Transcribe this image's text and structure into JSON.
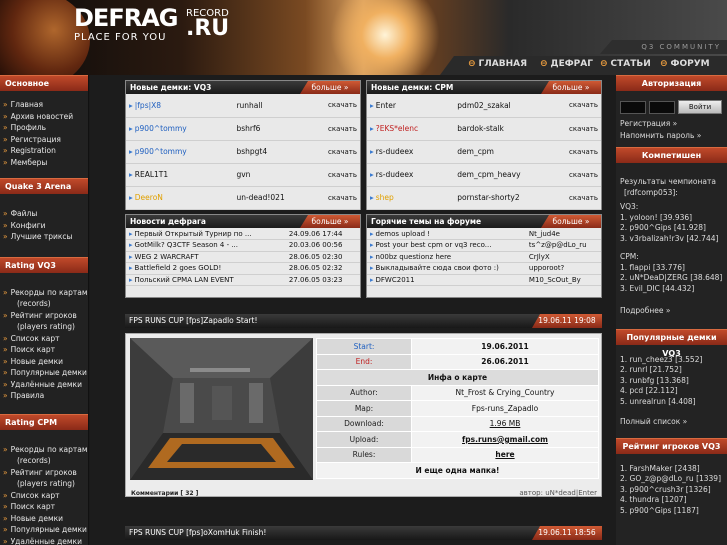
{
  "header": {
    "logo_main": "DEFRAG",
    "logo_record": "RECORD",
    "logo_ru": ".RU",
    "logo_sub": "PLACE FOR YOU",
    "community": "Q3 COMMUNITY",
    "nav": [
      {
        "label": "ГЛАВНАЯ",
        "icon": "circle-arrow-icon"
      },
      {
        "label": "ДЕФРАГ",
        "icon": "circle-arrow-icon"
      },
      {
        "label": "СТАТЬИ",
        "icon": "circle-arrow-icon"
      },
      {
        "label": "ФОРУМ",
        "icon": "circle-arrow-icon"
      }
    ]
  },
  "left_sidebar": {
    "sections": [
      {
        "title": "Основное",
        "items": [
          "Главная",
          "Архив новостей",
          "Профиль",
          "Регистрация",
          "Registration",
          "Мемберы"
        ]
      },
      {
        "title": "Quake 3 Arena",
        "items": [
          "Файлы",
          "Конфиги",
          "Лучшие триксы"
        ]
      },
      {
        "title": "Rating VQ3",
        "items": [
          "Рекорды по картам",
          "(records)",
          "Рейтинг игроков",
          "(players rating)",
          "Список карт",
          "Поиск карт",
          "Новые демки",
          "Популярные демки",
          "Удалённые демки",
          "Правила"
        ]
      },
      {
        "title": "Rating CPM",
        "items": [
          "Рекорды по картам",
          "(records)",
          "Рейтинг игроков",
          "(players rating)",
          "Список карт",
          "Поиск карт",
          "Новые демки",
          "Популярные демки",
          "Удалённые демки"
        ]
      }
    ]
  },
  "panels": {
    "more_label": "больше",
    "vq3": {
      "title": "Новые демки: VQ3",
      "rows": [
        {
          "name": "|fps|X8",
          "map": "runhall",
          "dl": "скачать"
        },
        {
          "name": "p900^tommy",
          "map": "bshrf6",
          "dl": "скачать"
        },
        {
          "name": "p900^tommy",
          "map": "bshpgt4",
          "dl": "скачать"
        },
        {
          "name": "REAL1T1",
          "map": "gvn",
          "dl": "скачать"
        },
        {
          "name": "DeeroN",
          "map": "un-dead!021",
          "dl": "скачать"
        }
      ]
    },
    "cpm": {
      "title": "Новые демки: CPM",
      "rows": [
        {
          "name": "Enter",
          "map": "pdm02_szakal",
          "dl": "скачать"
        },
        {
          "name": "?EKS*elenc",
          "map": "bardok-stalk",
          "dl": "скачать"
        },
        {
          "name": "rs-dudeex",
          "map": "dem_cpm",
          "dl": "скачать"
        },
        {
          "name": "rs-dudeex",
          "map": "dem_cpm_heavy",
          "dl": "скачать"
        },
        {
          "name": "shep",
          "map": "pornstar-shorty2",
          "dl": "скачать"
        }
      ]
    },
    "news": {
      "title": "Новости дефрага",
      "rows": [
        {
          "text": "Первый Открытый Турнир по ...",
          "date": "24.09.06 17:44"
        },
        {
          "text": "GotMilk? Q3CTF Season 4 - ...",
          "date": "20.03.06 00:56"
        },
        {
          "text": "WEG 2 WARCRAFT",
          "date": "28.06.05 02:30"
        },
        {
          "text": "Battlefield 2 goes GOLD!",
          "date": "28.06.05 02:32"
        },
        {
          "text": "Польский CPMA LAN EVENT",
          "date": "27.06.05 03:23"
        }
      ]
    },
    "forum": {
      "title": "Горячие темы на форуме",
      "rows": [
        {
          "text": "demos upload !",
          "user": "Nt_jud4e"
        },
        {
          "text": "Post your best cpm or vq3 reco...",
          "user": "ts^z@p@dLo_ru"
        },
        {
          "text": "n00bz questionz here",
          "user": "CrJlyX"
        },
        {
          "text": "Выкладывайте сюда свои фото :)",
          "user": "upporoot?"
        },
        {
          "text": "DFWC2011",
          "user": "M10_ScOut_By"
        }
      ]
    }
  },
  "post1": {
    "title": "FPS RUNS CUP [fps]Zapadlo Start!",
    "date": "19.06.11 19:08",
    "start_label": "Start:",
    "start": "19.06.2011",
    "end_label": "End:",
    "end": "26.06.2011",
    "info_heading": "Инфа о карте",
    "author_label": "Author:",
    "author": "Nt_Frost & Crying_Country",
    "map_label": "Map:",
    "map": "Fps-runs_Zapadlo",
    "download_label": "Download:",
    "download": "1.96 MB",
    "upload_label": "Upload:",
    "upload": "fps.runs@gmail.com",
    "rules_label": "Rules:",
    "rules": "here",
    "footer_note": "И еще одна мапка!",
    "comments": "Комментарии [ 32 ]",
    "byline": "автор: uN*dead|Enter"
  },
  "post2": {
    "title": "FPS RUNS CUP [fps]oXomHuk Finish!",
    "date": "19.06.11 18:56"
  },
  "right_sidebar": {
    "auth_title": "Авторизация",
    "login_button": "Войти",
    "register_link": "Регистрация »",
    "remind_link": "Напомнить пароль »",
    "comp_title": "Компетишен",
    "comp_intro": "Результаты чемпионата",
    "comp_name": "[rdfcomp053]:",
    "vq3_label": "VQ3:",
    "vq3_results": [
      "1. yoloon! [39.936]",
      "2. p900^Gips [41.928]",
      "3. v3rbalizah!r3v [42.744]"
    ],
    "cpm_label": "CPM:",
    "cpm_results": [
      "1. flappi [33.776]",
      "2. uN*DeaD|ZERG [38.648]",
      "3. Evil_DIC [44.432]"
    ],
    "more_link": "Подробнее »",
    "pop_title": "Популярные демки VQ3",
    "pop": [
      "1. run_cheez3 [3.552]",
      "2. runrl [21.752]",
      "3. runbfg [13.368]",
      "4. pcd [22.112]",
      "5. unrealrun [4.408]"
    ],
    "full_list": "Полный список »",
    "rating_title": "Рейтинг игроков VQ3",
    "rating": [
      "1. FarshMaker [2438]",
      "2. GO_z@p@dLo_ru [1339]",
      "3. p900^crush3r [1326]",
      "4. thundra [1207]",
      "5. p900^Gips [1187]"
    ]
  },
  "colors": {
    "accent": "#c0492a",
    "bullet": "#f0a040",
    "link_blue": "#2060c0"
  }
}
